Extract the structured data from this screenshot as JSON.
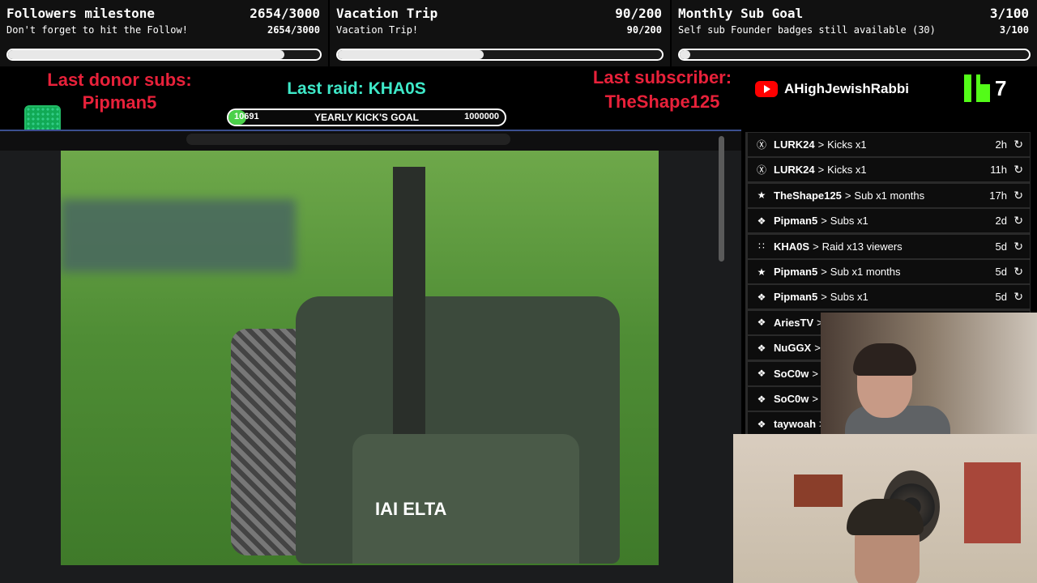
{
  "goals": [
    {
      "title": "Followers milestone",
      "count": "2654/3000",
      "subtitle": "Don't forget to hit the Follow!",
      "sub_count": "2654/3000",
      "progress": 0.885
    },
    {
      "title": "Vacation Trip",
      "count": "90/200",
      "subtitle": "Vacation Trip!",
      "sub_count": "90/200",
      "progress": 0.45
    },
    {
      "title": "Monthly Sub Goal",
      "count": "3/100",
      "subtitle": "Self sub Founder badges still available (30)",
      "sub_count": "3/100",
      "progress": 0.03
    }
  ],
  "alerts": {
    "donor_label": "Last donor subs:",
    "donor_name": "Pipman5",
    "raid": "Last raid: KHA0S",
    "subscriber_label": "Last subscriber:",
    "subscriber_name": "TheShape125"
  },
  "yearly_goal": {
    "current": "10691",
    "label": "YEARLY KICK'S GOAL",
    "max": "1000000",
    "progress": 0.0107
  },
  "youtube": {
    "channel": "AHighJewishRabbi"
  },
  "kick": {
    "count": "7"
  },
  "video": {
    "brand": "IAI ELTA"
  },
  "events": [
    {
      "icon": "kick-icon",
      "glyph": "Ⓧ",
      "user": "LURK24",
      "sep": ">",
      "action": "Kicks x1",
      "time": "2h"
    },
    {
      "icon": "kick-icon",
      "glyph": "Ⓧ",
      "user": "LURK24",
      "sep": ">",
      "action": "Kicks x1",
      "time": "11h"
    },
    {
      "icon": "star-icon",
      "glyph": "★",
      "user": "TheShape125",
      "sep": ">",
      "action": "Sub x1 months",
      "time": "17h"
    },
    {
      "icon": "gift-icon",
      "glyph": "❖",
      "user": "Pipman5",
      "sep": ">",
      "action": "Subs x1",
      "time": "2d"
    },
    {
      "icon": "raid-icon",
      "glyph": "∷",
      "user": "KHA0S",
      "sep": ">",
      "action": "Raid x13 viewers",
      "time": "5d"
    },
    {
      "icon": "star-icon",
      "glyph": "★",
      "user": "Pipman5",
      "sep": ">",
      "action": "Sub x1 months",
      "time": "5d"
    },
    {
      "icon": "gift-icon",
      "glyph": "❖",
      "user": "Pipman5",
      "sep": ">",
      "action": "Subs x1",
      "time": "5d"
    },
    {
      "icon": "gift-icon",
      "glyph": "❖",
      "user": "AriesTV",
      "sep": ">",
      "action": "",
      "time": ""
    },
    {
      "icon": "gift-icon",
      "glyph": "❖",
      "user": "NuGGX",
      "sep": ">",
      "action": "",
      "time": ""
    },
    {
      "icon": "gift-icon",
      "glyph": "❖",
      "user": "SoC0w",
      "sep": ">",
      "action": "",
      "time": ""
    },
    {
      "icon": "gift-icon",
      "glyph": "❖",
      "user": "SoC0w",
      "sep": ">",
      "action": "",
      "time": ""
    },
    {
      "icon": "gift-icon",
      "glyph": "❖",
      "user": "taywoah",
      "sep": ">",
      "action": "",
      "time": ""
    }
  ],
  "colors": {
    "alert_red": "#e8213a",
    "raid_teal": "#3ee8c8",
    "kick_green": "#53fc18",
    "youtube_red": "#ff0000"
  }
}
